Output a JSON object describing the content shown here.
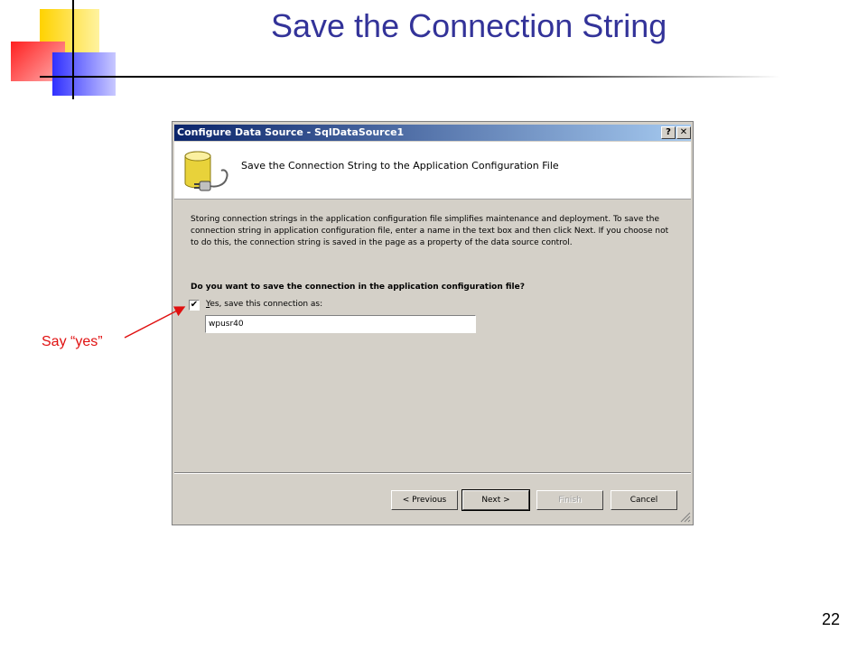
{
  "slide": {
    "title": "Save the Connection String",
    "page_number": "22",
    "annotation": "Say “yes”"
  },
  "dialog": {
    "title": "Configure Data Source - SqlDataSource1",
    "help_button": "?",
    "close_button": "✕",
    "header_title": "Save the Connection String to the Application Configuration File",
    "header_icon": "database-plug-icon",
    "description": "Storing connection strings in the application configuration file simplifies maintenance and deployment. To save the connection string in application configuration file, enter a name in the text box and then click Next. If you choose not to do this, the connection string is saved in the page as a property of the data source control.",
    "question": "Do you want to save the connection in the application configuration file?",
    "checkbox_checked": true,
    "checkbox_label": "Yes, save this connection as:",
    "connection_name": "wpusr40",
    "buttons": {
      "previous": "< Previous",
      "next": "Next >",
      "finish": "Finish",
      "cancel": "Cancel"
    }
  },
  "colors": {
    "title": "#333399",
    "annotation": "#e01010",
    "titlebar_start": "#0a246a",
    "titlebar_end": "#a6caf0",
    "dialog_bg": "#d4d0c8"
  }
}
